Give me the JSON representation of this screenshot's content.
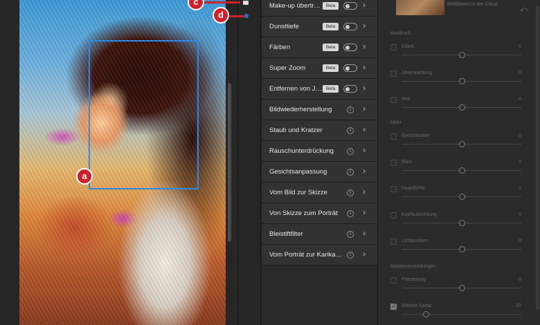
{
  "callouts": {
    "a": "a",
    "c": "c",
    "d": "d"
  },
  "filters": [
    {
      "name": "Make-up übertr…",
      "beta": "Beta",
      "control": "toggle"
    },
    {
      "name": "Dunsttiefe",
      "beta": "Beta",
      "control": "toggle"
    },
    {
      "name": "Färben",
      "beta": "Beta",
      "control": "toggle"
    },
    {
      "name": "Super Zoom",
      "beta": "Beta",
      "control": "toggle"
    },
    {
      "name": "Entfernen von J…",
      "beta": "Beta",
      "control": "toggle"
    },
    {
      "name": "Bildwiederherstellung",
      "control": "info"
    },
    {
      "name": "Staub und Kratzer",
      "control": "info"
    },
    {
      "name": "Rauschunterdrückung",
      "control": "info"
    },
    {
      "name": "Gesichtsanpassung",
      "control": "info"
    },
    {
      "name": "Vom Bild zur Skizze",
      "control": "info"
    },
    {
      "name": "Von Skizze zum Porträt",
      "control": "info"
    },
    {
      "name": "Bleistiftfilter",
      "control": "info"
    },
    {
      "name": "Vom Porträt zur Karika…",
      "control": "info"
    }
  ],
  "properties": {
    "cloud_text": "Bildddaten in der Cloud",
    "sections": [
      {
        "title": "Ausdruck",
        "sliders": [
          {
            "label": "Glück",
            "value": "0",
            "level": 0.5,
            "checked": false
          },
          {
            "label": "Überraschung",
            "value": "0",
            "level": 0.5,
            "checked": false
          },
          {
            "label": "Wut",
            "value": "0",
            "level": 0.5,
            "checked": false
          }
        ]
      },
      {
        "title": "Mehr",
        "sliders": [
          {
            "label": "Gesichtsalter",
            "value": "0",
            "level": 0.5,
            "checked": false
          },
          {
            "label": "Blick",
            "value": "0",
            "level": 0.5,
            "checked": false
          },
          {
            "label": "Haardichte",
            "value": "0",
            "level": 0.5,
            "checked": false
          },
          {
            "label": "Kopfausrichtung",
            "value": "0",
            "level": 0.5,
            "checked": false
          },
          {
            "label": "Lichtposition",
            "value": "0",
            "level": 0.5,
            "checked": false
          }
        ]
      },
      {
        "title": "Maskeneinstellungen",
        "sliders": [
          {
            "label": "Platzierung",
            "value": "0",
            "level": 0.5,
            "checked": false
          },
          {
            "label": "Weiche Kante",
            "value": "20",
            "level": 0.2,
            "checked": true
          }
        ]
      }
    ]
  }
}
